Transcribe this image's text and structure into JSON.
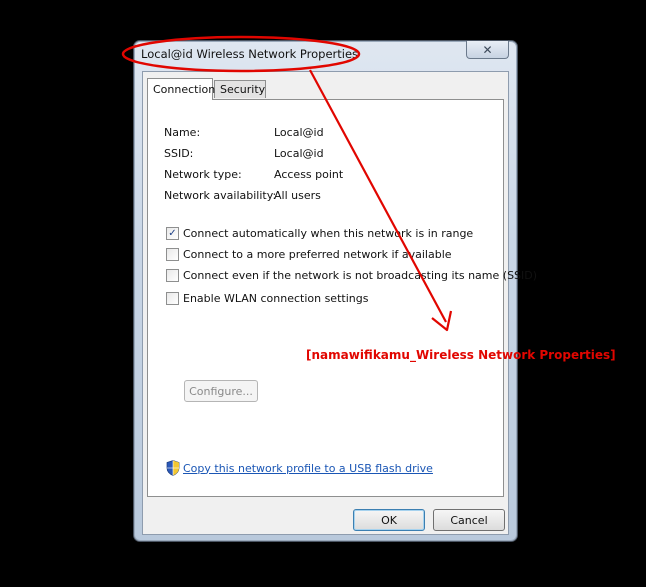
{
  "window": {
    "title": "Local@id Wireless Network Properties",
    "close_glyph": "✕"
  },
  "tabs": [
    {
      "label": "Connection",
      "active": true
    },
    {
      "label": "Security",
      "active": false
    }
  ],
  "info": {
    "rows": [
      {
        "label": "Name:",
        "value": "Local@id"
      },
      {
        "label": "SSID:",
        "value": "Local@id"
      },
      {
        "label": "Network type:",
        "value": "Access point"
      },
      {
        "label": "Network availability:",
        "value": "All users"
      }
    ]
  },
  "options": [
    {
      "label": "Connect automatically when this network is in range",
      "checked": true
    },
    {
      "label": "Connect to a more preferred network if available",
      "checked": false
    },
    {
      "label": "Connect even if the network is not broadcasting its name (SSID)",
      "checked": false
    },
    {
      "label": "Enable WLAN connection settings",
      "checked": false
    }
  ],
  "configure_label": "Configure...",
  "usb_link": "Copy this network profile to a USB flash drive",
  "buttons": {
    "ok": "OK",
    "cancel": "Cancel"
  },
  "annotation": {
    "caption": "[namawifikamu_Wireless Network Properties]",
    "color": "#e10600"
  },
  "icons": {
    "shield": "uac-shield-icon",
    "check": "✓"
  }
}
